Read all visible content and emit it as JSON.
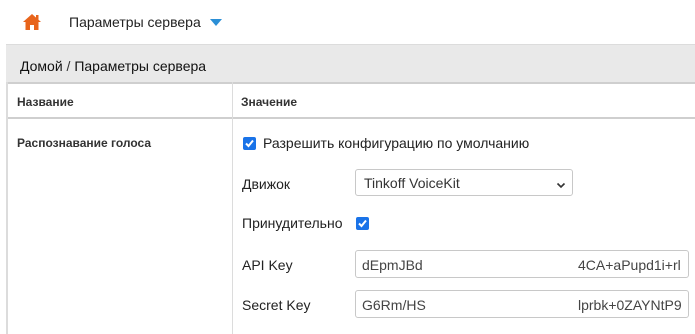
{
  "header": {
    "title": "Параметры сервера",
    "home_icon": "home-icon",
    "dropdown_icon": "caret-down-icon",
    "accent_color": "#2b8fd6",
    "home_color": "#e8641b"
  },
  "breadcrumb": {
    "home": "Домой",
    "separator": "/",
    "current": "Параметры сервера"
  },
  "table": {
    "col_name": "Название",
    "col_value": "Значение"
  },
  "voice": {
    "section_label": "Распознавание голоса",
    "allow_default_label": "Разрешить конфигурацию по умолчанию",
    "allow_default_checked": true,
    "engine_label": "Движок",
    "engine_value": "Tinkoff VoiceKit",
    "force_label": "Принудительно",
    "force_checked": true,
    "api_key_label": "API Key",
    "api_key_value_start": "dEpmJBd",
    "api_key_value_end": "4CA+aPupd1i+rl",
    "secret_key_label": "Secret Key",
    "secret_key_value_start": "G6Rm/HS",
    "secret_key_value_end": "lprbk+0ZAYNtP9"
  }
}
